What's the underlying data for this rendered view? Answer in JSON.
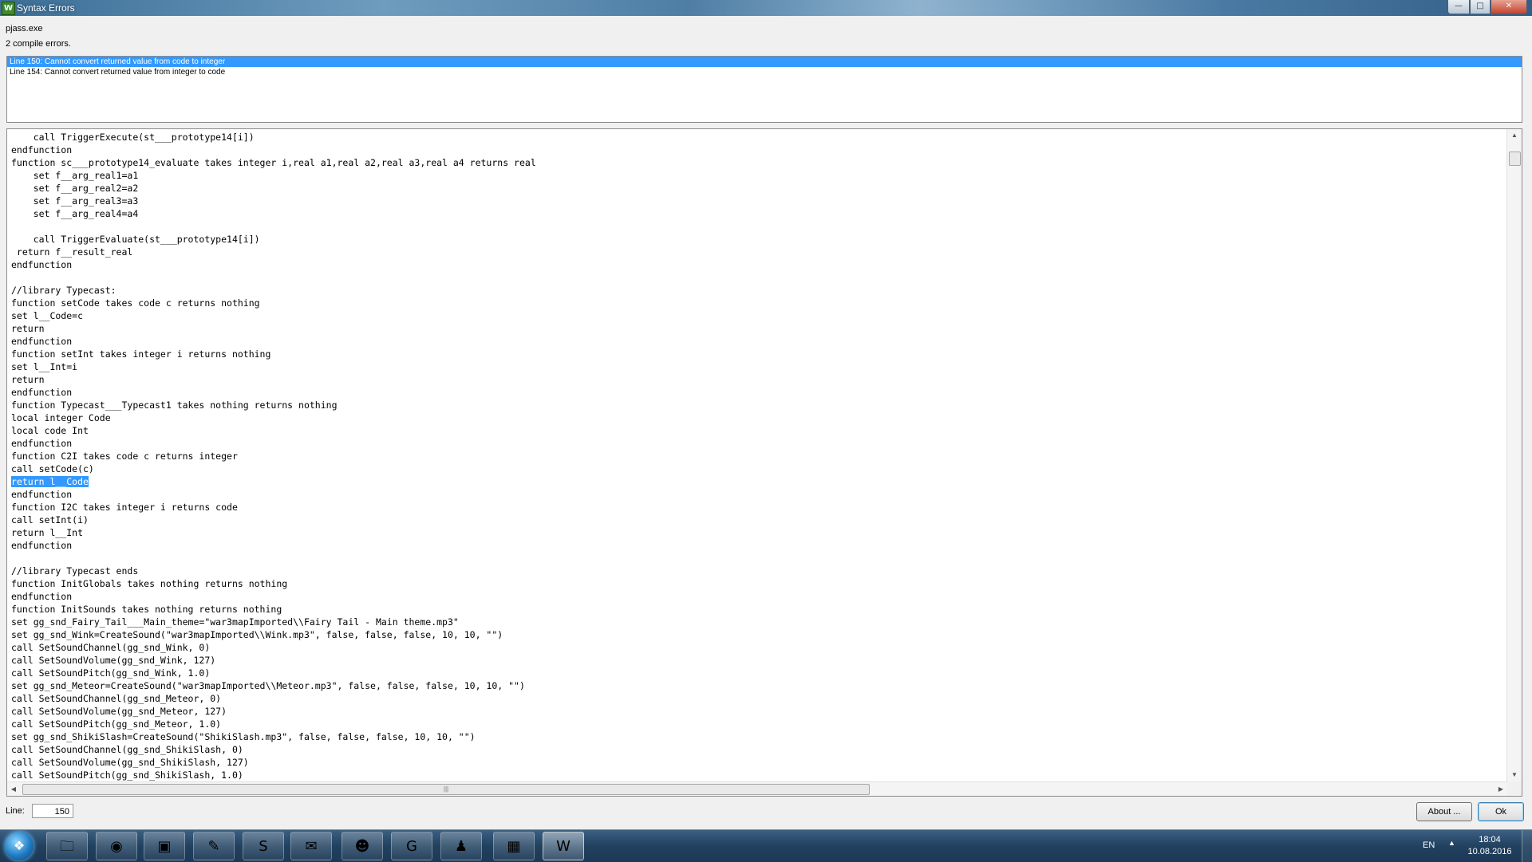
{
  "window": {
    "title": "Syntax Errors",
    "app_icon_glyph": "W",
    "controls": {
      "minimize": "—",
      "maximize": "□",
      "close": "✕"
    }
  },
  "header": {
    "exe": "pjass.exe",
    "count": "2 compile errors."
  },
  "errors": [
    "Line 150:  Cannot convert returned value from code to integer",
    "Line 154:  Cannot convert returned value from integer to code"
  ],
  "code": {
    "lines": [
      "    call TriggerExecute(st___prototype14[i])",
      "endfunction",
      "function sc___prototype14_evaluate takes integer i,real a1,real a2,real a3,real a4 returns real",
      "    set f__arg_real1=a1",
      "    set f__arg_real2=a2",
      "    set f__arg_real3=a3",
      "    set f__arg_real4=a4",
      "",
      "    call TriggerEvaluate(st___prototype14[i])",
      " return f__result_real",
      "endfunction",
      "",
      "//library Typecast:",
      "function setCode takes code c returns nothing",
      "set l__Code=c",
      "return",
      "endfunction",
      "function setInt takes integer i returns nothing",
      "set l__Int=i",
      "return",
      "endfunction",
      "function Typecast___Typecast1 takes nothing returns nothing",
      "local integer Code",
      "local code Int",
      "endfunction",
      "function C2I takes code c returns integer",
      "call setCode(c)",
      "return l__Code",
      "endfunction",
      "function I2C takes integer i returns code",
      "call setInt(i)",
      "return l__Int",
      "endfunction",
      "",
      "//library Typecast ends",
      "function InitGlobals takes nothing returns nothing",
      "endfunction",
      "function InitSounds takes nothing returns nothing",
      "set gg_snd_Fairy_Tail___Main_theme=\"war3mapImported\\\\Fairy Tail - Main theme.mp3\"",
      "set gg_snd_Wink=CreateSound(\"war3mapImported\\\\Wink.mp3\", false, false, false, 10, 10, \"\")",
      "call SetSoundChannel(gg_snd_Wink, 0)",
      "call SetSoundVolume(gg_snd_Wink, 127)",
      "call SetSoundPitch(gg_snd_Wink, 1.0)",
      "set gg_snd_Meteor=CreateSound(\"war3mapImported\\\\Meteor.mp3\", false, false, false, 10, 10, \"\")",
      "call SetSoundChannel(gg_snd_Meteor, 0)",
      "call SetSoundVolume(gg_snd_Meteor, 127)",
      "call SetSoundPitch(gg_snd_Meteor, 1.0)",
      "set gg_snd_ShikiSlash=CreateSound(\"ShikiSlash.mp3\", false, false, false, 10, 10, \"\")",
      "call SetSoundChannel(gg_snd_ShikiSlash, 0)",
      "call SetSoundVolume(gg_snd_ShikiSlash, 127)",
      "call SetSoundPitch(gg_snd_ShikiSlash, 1.0)"
    ],
    "highlighted_line": 27
  },
  "scrollbars": {
    "up": "▲",
    "down": "▼",
    "left": "◀",
    "right": "▶",
    "grip": "|||"
  },
  "footer": {
    "line_label": "Line:",
    "line_value": "150",
    "about_label": "About ...",
    "ok_label": "Ok"
  },
  "taskbar": {
    "start_glyph": "❖",
    "apps": [
      {
        "name": "explorer-folder-icon",
        "glyph": "🗀"
      },
      {
        "name": "browser-icon",
        "glyph": "◉"
      },
      {
        "name": "window-app-icon",
        "glyph": "▣"
      },
      {
        "name": "pen-tool-icon",
        "glyph": "✎"
      },
      {
        "name": "skype-icon",
        "glyph": "S"
      },
      {
        "name": "scroll-editor-icon",
        "glyph": "✉"
      },
      {
        "name": "pumpkin-game-icon",
        "glyph": "☻"
      },
      {
        "name": "garena-icon",
        "glyph": "G"
      },
      {
        "name": "red-figure-icon",
        "glyph": "♟"
      },
      {
        "name": "warcraft-icon",
        "glyph": "▦"
      },
      {
        "name": "world-editor-icon",
        "glyph": "W"
      }
    ],
    "lang": "EN",
    "tray_arrow": "▲",
    "time": "18:04",
    "date": "10.08.2016"
  },
  "colors": {
    "selection": "#3399ff",
    "taskbar": "#22415f"
  }
}
